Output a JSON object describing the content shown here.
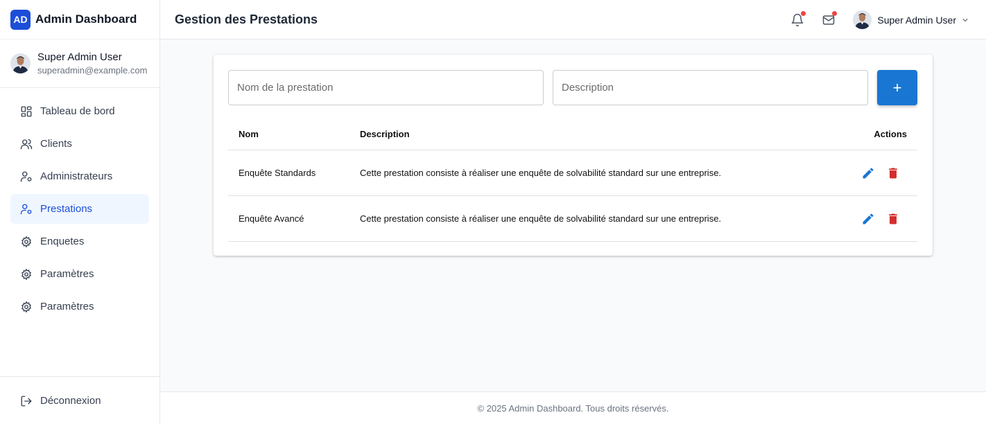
{
  "brand": {
    "logo_text": "AD",
    "title": "Admin Dashboard"
  },
  "user": {
    "name": "Super Admin User",
    "email": "superadmin@example.com"
  },
  "nav": {
    "items": [
      {
        "label": "Tableau de bord",
        "icon": "dashboard-icon"
      },
      {
        "label": "Clients",
        "icon": "users-icon"
      },
      {
        "label": "Administrateurs",
        "icon": "user-cog-icon"
      },
      {
        "label": "Prestations",
        "icon": "user-cog-icon",
        "active": true
      },
      {
        "label": "Enquetes",
        "icon": "gear-icon"
      },
      {
        "label": "Paramètres",
        "icon": "gear-icon"
      },
      {
        "label": "Paramètres",
        "icon": "gear-icon"
      }
    ],
    "logout_label": "Déconnexion"
  },
  "header": {
    "title": "Gestion des Prestations",
    "user_name": "Super Admin User",
    "notification_dot": true,
    "mail_dot": true
  },
  "form": {
    "name_placeholder": "Nom de la prestation",
    "desc_placeholder": "Description",
    "add_label": "+"
  },
  "table": {
    "headers": {
      "nom": "Nom",
      "description": "Description",
      "actions": "Actions"
    },
    "rows": [
      {
        "nom": "Enquête Standards",
        "description": "Cette prestation consiste à réaliser une enquête de solvabilité standard sur une entreprise."
      },
      {
        "nom": "Enquête Avancé",
        "description": "Cette prestation consiste à réaliser une enquête de solvabilité standard sur une entreprise."
      }
    ]
  },
  "footer": {
    "text": "© 2025 Admin Dashboard. Tous droits réservés."
  },
  "colors": {
    "primary": "#1976d2",
    "accent": "#1d4ed8",
    "danger": "#d32f2f",
    "active_bg": "#eff6ff"
  }
}
